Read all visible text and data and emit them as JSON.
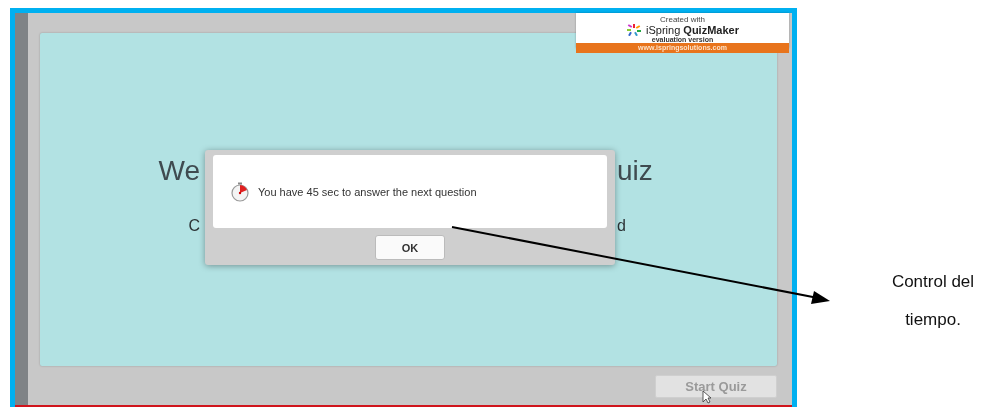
{
  "quiz_window": {
    "badge": {
      "line_1": "Created with",
      "brand": "iSpring **QuizMaker**",
      "line_3": "evaluation version",
      "url": "www.ispringsolutions.com"
    },
    "heading_fragments": [
      "We",
      "uiz"
    ],
    "subtitle_fragments": [
      "C",
      "d"
    ],
    "dialog": {
      "message": "You have 45 sec to answer the next question",
      "button": "OK"
    },
    "start_button": {
      "label": "Start Quiz",
      "disabled": true
    }
  },
  "annotation": {
    "lines": [
      "Control del",
      "tiempo."
    ]
  }
}
